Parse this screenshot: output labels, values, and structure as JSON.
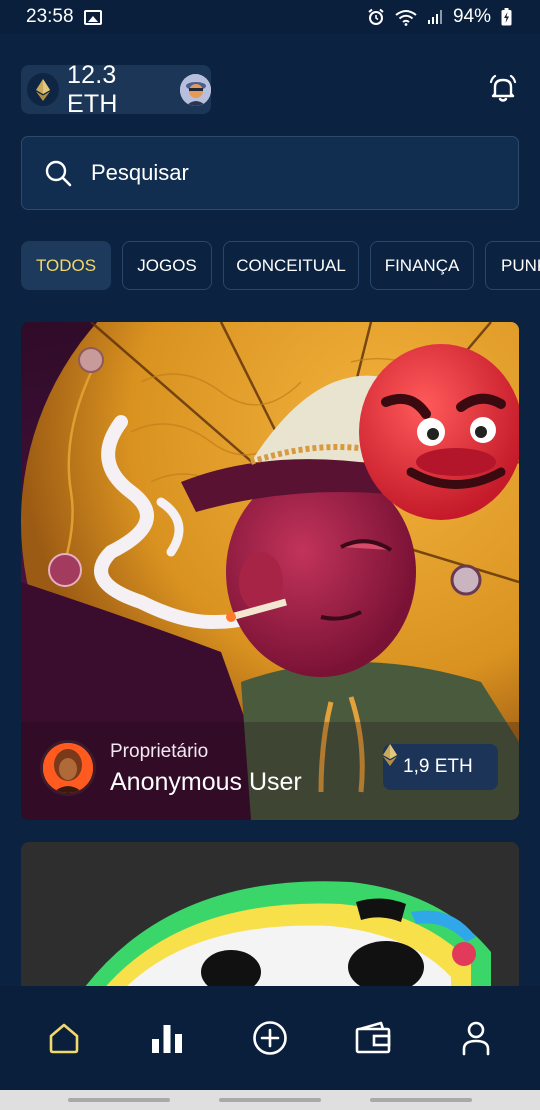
{
  "status_bar": {
    "time": "23:58",
    "battery": "94%"
  },
  "header": {
    "balance": "12.3 ETH"
  },
  "search": {
    "placeholder": "Pesquisar"
  },
  "tabs": [
    {
      "label": "TODOS",
      "active": true
    },
    {
      "label": "JOGOS",
      "active": false
    },
    {
      "label": "CONCEITUAL",
      "active": false
    },
    {
      "label": "FINANÇA",
      "active": false
    },
    {
      "label": "PUNK",
      "active": false
    }
  ],
  "cards": [
    {
      "owner_label": "Proprietário",
      "owner_name": "Anonymous User",
      "price": "1,9 ETH"
    }
  ],
  "bottom_nav": [
    {
      "icon": "home-icon",
      "active": true
    },
    {
      "icon": "stats-icon",
      "active": false
    },
    {
      "icon": "add-circle-icon",
      "active": false
    },
    {
      "icon": "wallet-icon",
      "active": false
    },
    {
      "icon": "profile-icon",
      "active": false
    }
  ],
  "colors": {
    "background": "#0b2240",
    "accent": "#f3d86a",
    "chip": "#1b3656"
  }
}
